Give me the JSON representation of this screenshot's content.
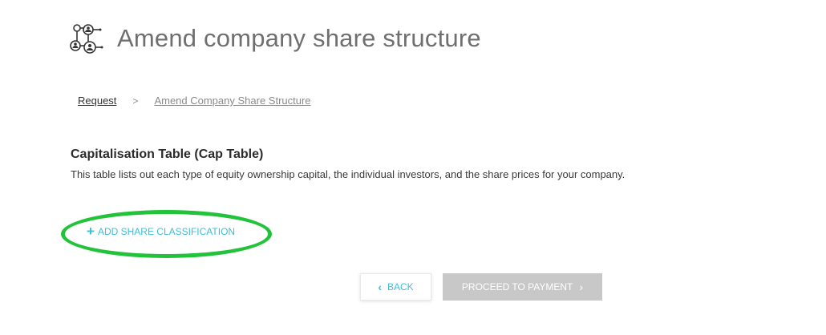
{
  "header": {
    "icon": "share-structure-icon",
    "title": "Amend company share structure"
  },
  "breadcrumb": {
    "items": [
      "Request",
      "Amend Company Share Structure"
    ],
    "separator": ">"
  },
  "section": {
    "title": "Capitalisation Table (Cap Table)",
    "description": "This table lists out each type of equity ownership capital, the individual investors, and the share prices for your company."
  },
  "actions": {
    "add_share_icon": "plus-icon",
    "add_share_label": "ADD SHARE CLASSIFICATION",
    "back_icon": "chevron-left-icon",
    "back_label": "BACK",
    "proceed_label": "PROCEED TO PAYMENT",
    "proceed_icon": "chevron-right-icon"
  },
  "colors": {
    "accent": "#3bbfd8",
    "highlight": "#22c23a",
    "disabled_button": "#c8c8c8",
    "title_gray": "#6f6f6f"
  }
}
